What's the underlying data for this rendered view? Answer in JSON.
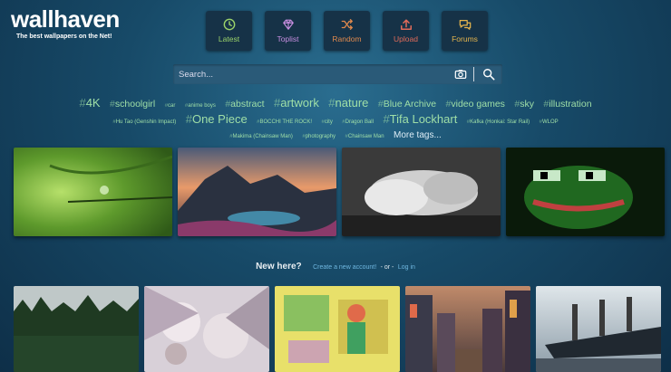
{
  "brand": {
    "name": "wallhaven",
    "tagline": "The best wallpapers on the Net!"
  },
  "nav": [
    {
      "label": "Latest",
      "color": "#9bd36a",
      "icon": "clock-icon"
    },
    {
      "label": "Toplist",
      "color": "#c78ee0",
      "icon": "gem-icon"
    },
    {
      "label": "Random",
      "color": "#e0894d",
      "icon": "shuffle-icon"
    },
    {
      "label": "Upload",
      "color": "#e06b5a",
      "icon": "upload-icon"
    },
    {
      "label": "Forums",
      "color": "#e6b54d",
      "icon": "chat-icon"
    }
  ],
  "search": {
    "placeholder": "Search..."
  },
  "tags": {
    "row1": [
      {
        "label": "4K"
      },
      {
        "label": "schoolgirl"
      },
      {
        "label": "car"
      },
      {
        "label": "anime boys"
      },
      {
        "label": "abstract"
      },
      {
        "label": "artwork"
      },
      {
        "label": "nature"
      },
      {
        "label": "Blue Archive"
      },
      {
        "label": "video games"
      },
      {
        "label": "sky"
      },
      {
        "label": "illustration"
      }
    ],
    "row2": [
      {
        "label": "Hu Tao (Genshin Impact)"
      },
      {
        "label": "One Piece"
      },
      {
        "label": "BOCCHI THE ROCK!"
      },
      {
        "label": "city"
      },
      {
        "label": "Dragon Ball"
      },
      {
        "label": "Tifa Lockhart"
      },
      {
        "label": "Kafka (Honkai: Star Rail)"
      },
      {
        "label": "WLOP"
      }
    ],
    "row3": [
      {
        "label": "Makima (Chainsaw Man)"
      },
      {
        "label": "photography"
      },
      {
        "label": "Chainsaw Man"
      }
    ],
    "more": "More tags..."
  },
  "newhere": {
    "heading": "New here?",
    "create": "Create a new account!",
    "or": "- or -",
    "login": "Log in"
  }
}
